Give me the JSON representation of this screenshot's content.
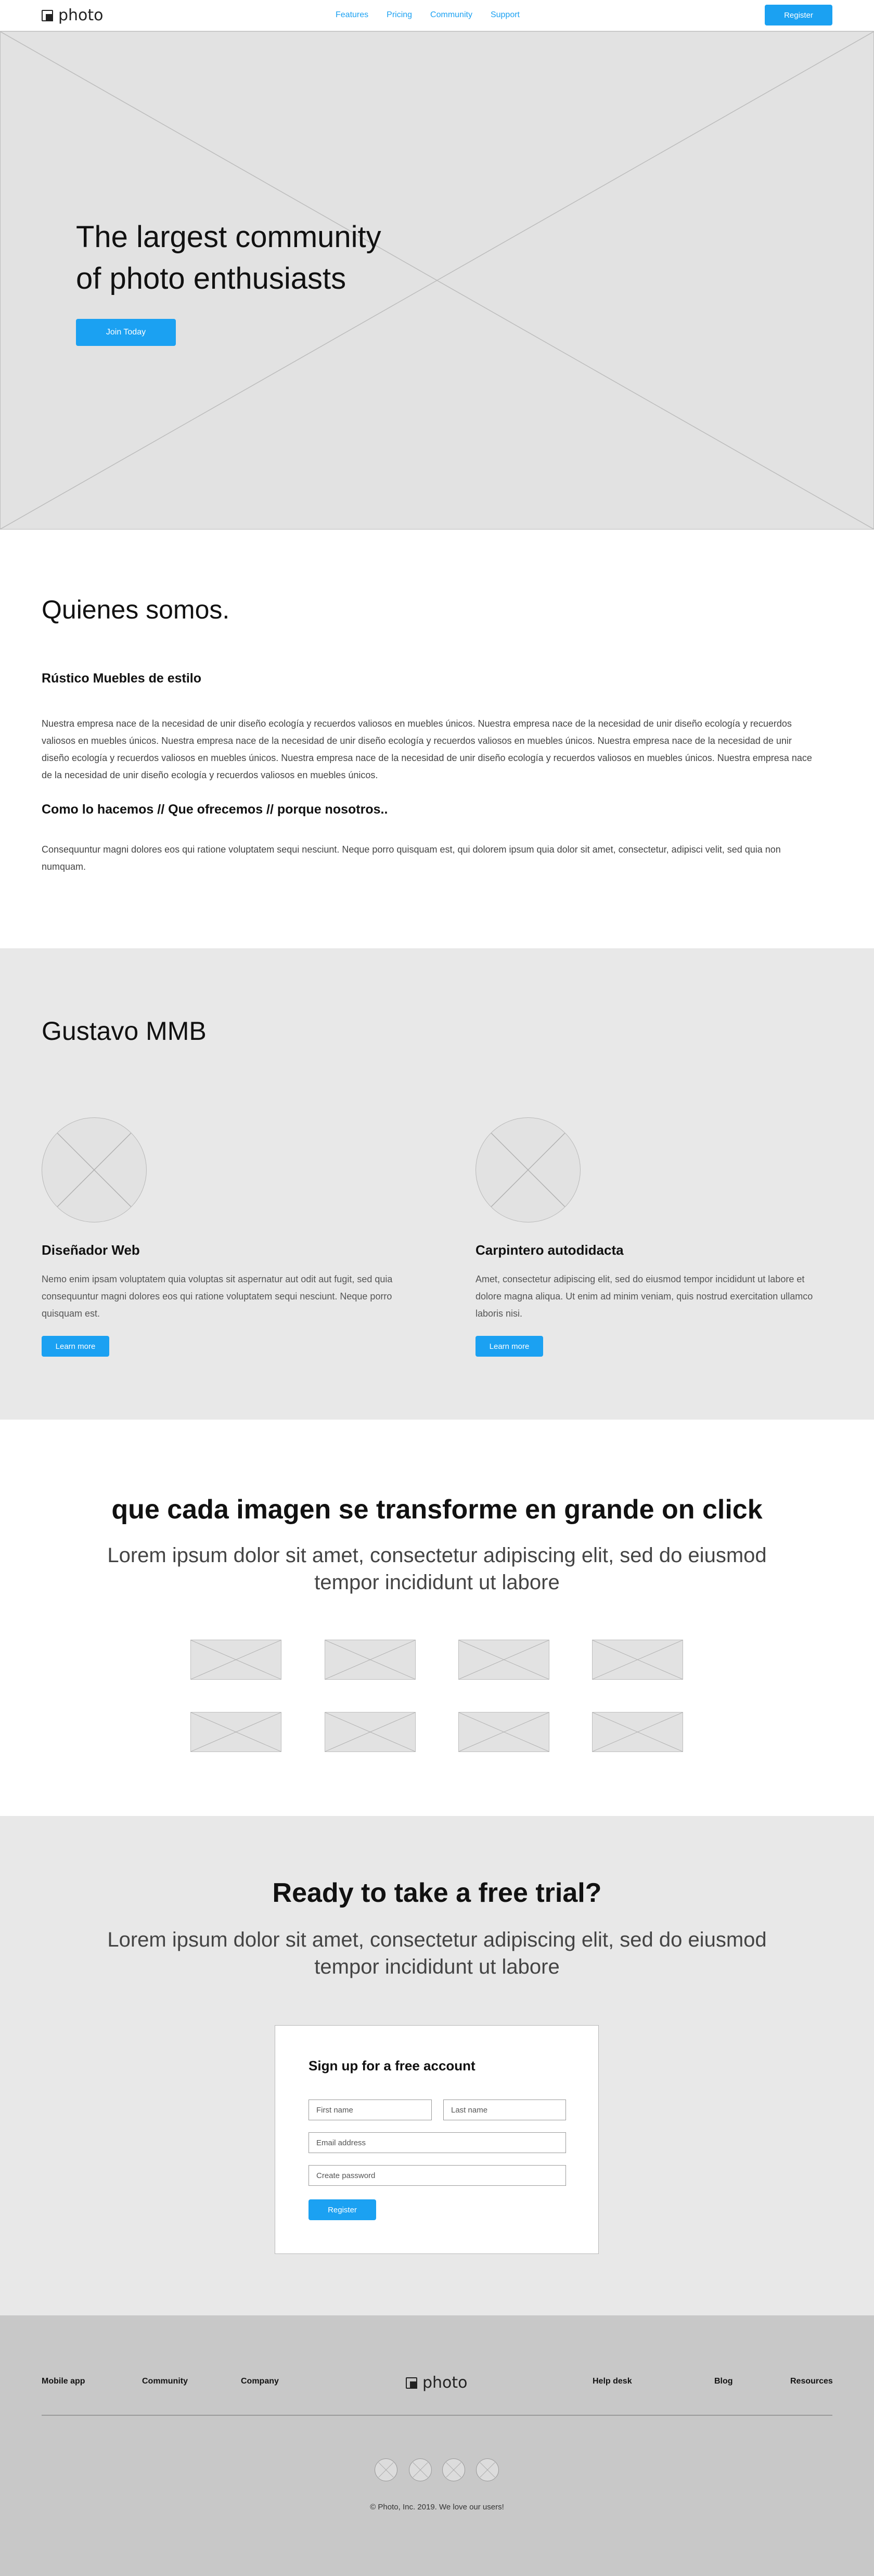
{
  "nav": {
    "logo_text": "photo",
    "links": [
      "Features",
      "Pricing",
      "Community",
      "Support"
    ],
    "register_label": "Register"
  },
  "hero": {
    "title_line1": "The largest community",
    "title_line2": "of photo enthusiasts",
    "cta_label": "Join Today"
  },
  "about": {
    "title": "Quienes somos.",
    "heading1": "Rústico Muebles de estilo",
    "paragraph1": "Nuestra empresa nace de la necesidad de unir diseño ecología y recuerdos valiosos en muebles únicos. Nuestra empresa nace de la necesidad de unir diseño ecología y recuerdos valiosos en muebles únicos. Nuestra empresa nace de la necesidad de unir diseño ecología y recuerdos valiosos en muebles únicos. Nuestra empresa nace de la necesidad de unir diseño ecología y recuerdos valiosos en muebles únicos. Nuestra empresa nace de la necesidad de unir diseño ecología y recuerdos valiosos en muebles únicos. Nuestra empresa nace de la necesidad de unir diseño ecología y recuerdos valiosos en muebles únicos.",
    "heading2": "Como lo hacemos // Que ofrecemos // porque nosotros..",
    "paragraph2": "Consequuntur magni dolores eos qui ratione voluptatem sequi nesciunt. Neque porro quisquam est, qui dolorem ipsum quia dolor sit amet, consectetur, adipisci velit, sed quia non numquam."
  },
  "team": {
    "title": "Gustavo MMB",
    "members": [
      {
        "name": "Diseñador Web",
        "text": "Nemo enim ipsam voluptatem quia voluptas sit aspernatur aut odit aut fugit, sed quia consequuntur magni dolores eos qui ratione voluptatem sequi nesciunt. Neque porro quisquam est.",
        "button": "Learn more"
      },
      {
        "name": "Carpintero autodidacta",
        "text": "Amet, consectetur adipiscing elit, sed do eiusmod tempor incididunt ut labore et dolore magna aliqua. Ut enim ad minim veniam, quis nostrud exercitation ullamco laboris nisi.",
        "button": "Learn more"
      }
    ]
  },
  "gallery": {
    "title": "que cada imagen se transforme en grande on click",
    "subtitle": "Lorem ipsum dolor sit amet, consectetur adipiscing elit, sed do eiusmod tempor incididunt ut labore"
  },
  "trial": {
    "title": "Ready to take a free trial?",
    "subtitle": "Lorem ipsum dolor sit amet, consectetur adipiscing elit, sed do eiusmod tempor incididunt ut labore",
    "form": {
      "title": "Sign up for a free account",
      "first_name_placeholder": "First name",
      "last_name_placeholder": "Last name",
      "email_placeholder": "Email address",
      "password_placeholder": "Create password",
      "submit_label": "Register"
    }
  },
  "footer": {
    "left_links": [
      "Mobile app",
      "Community",
      "Company"
    ],
    "logo_text": "photo",
    "right_links": [
      "Help desk",
      "Blog",
      "Resources"
    ],
    "copyright": "© Photo, Inc. 2019. We love our users!"
  }
}
